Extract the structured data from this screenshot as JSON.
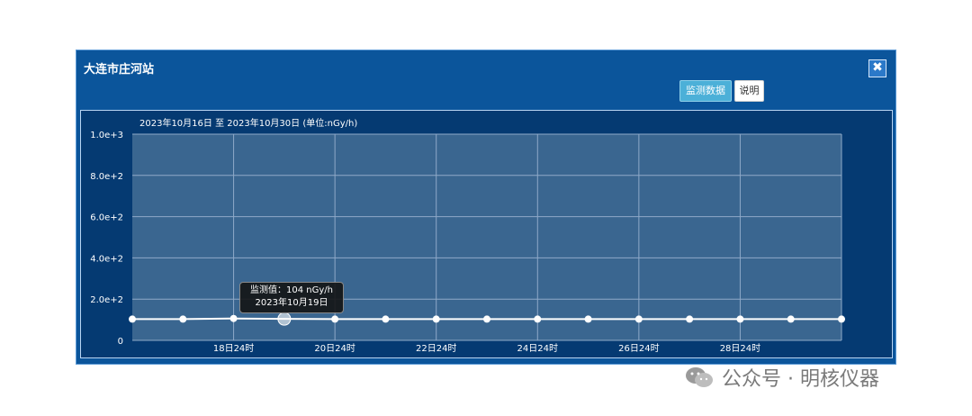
{
  "window": {
    "title": "大连市庄河站",
    "close_symbol": "✖"
  },
  "toolbar": {
    "monitor_data_label": "监测数据",
    "help_label": "说明"
  },
  "chart_data": {
    "type": "line",
    "caption": "2023年10月16日 至 2023年10月30日 (单位:nGy/h)",
    "x_tick_labels": [
      "18日24时",
      "20日24时",
      "22日24时",
      "24日24时",
      "26日24时",
      "28日24时"
    ],
    "y_tick_labels": [
      "0",
      "2.0e+2",
      "4.0e+2",
      "6.0e+2",
      "8.0e+2",
      "1.0e+3"
    ],
    "ylim": [
      0,
      1000
    ],
    "x": [
      "2023-10-16",
      "2023-10-17",
      "2023-10-18",
      "2023-10-19",
      "2023-10-20",
      "2023-10-21",
      "2023-10-22",
      "2023-10-23",
      "2023-10-24",
      "2023-10-25",
      "2023-10-26",
      "2023-10-27",
      "2023-10-28",
      "2023-10-29",
      "2023-10-30"
    ],
    "values": [
      103,
      103,
      106,
      104,
      103,
      103,
      103,
      103,
      103,
      103,
      103,
      103,
      103,
      103,
      103
    ],
    "grid": true,
    "line_color": "#ffffff",
    "plot_bg": "#3a6690",
    "tooltip": {
      "value_text": "监测值：104 nGy/h",
      "date_text": "2023年10月19日",
      "highlight_index": 3
    }
  },
  "watermark": {
    "text": "公众号 · 明核仪器",
    "icon": "wechat-icon"
  }
}
